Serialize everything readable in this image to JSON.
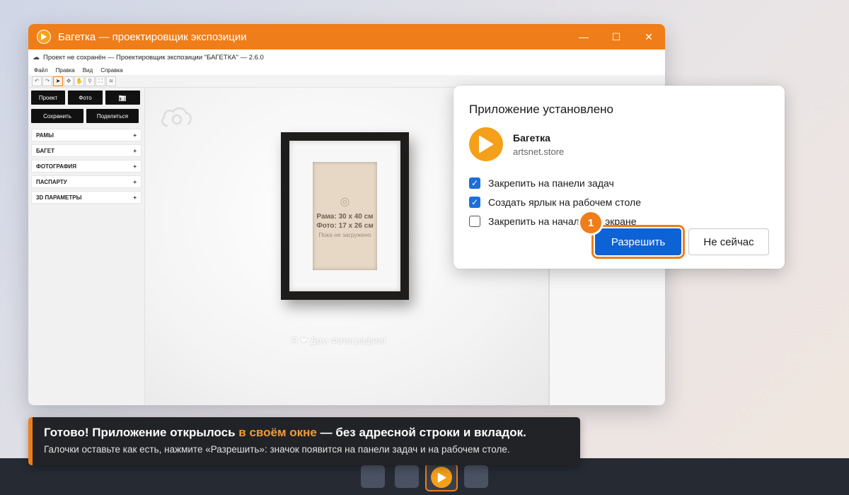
{
  "window": {
    "title": "Багетка — проектировщик экспозиции",
    "controls": {
      "minimize": "—",
      "maximize": "☐",
      "close": "✕"
    },
    "subtitle": "Проект не сохранён — Проектировщик экспозиции \"БАГЕТКА\"  — 2.6.0",
    "menu": [
      "Файл",
      "Правка",
      "Вид",
      "Справка"
    ],
    "toolbar_icons": [
      "undo-icon",
      "redo-icon",
      "pointer-icon",
      "move-icon",
      "hand-icon",
      "zoom-icon",
      "fit-icon",
      "layers-icon"
    ],
    "toolbar_glyphs": [
      "↶",
      "↷",
      "➤",
      "✥",
      "✋",
      "⚲",
      "⛶",
      "≋"
    ]
  },
  "sidebar": {
    "buttons": {
      "project": "Проект",
      "photo": "Фото",
      "camera": "📷",
      "save": "Сохранить",
      "share": "Поделиться"
    },
    "sections": [
      {
        "label": "РАМЫ",
        "toggle": "+"
      },
      {
        "label": "БАГЕТ",
        "toggle": "+"
      },
      {
        "label": "ФОТОГРАФИЯ",
        "toggle": "+"
      },
      {
        "label": "ПАСПАРТУ",
        "toggle": "+"
      },
      {
        "label": "3D ПАРАМЕТРЫ",
        "toggle": "+"
      }
    ]
  },
  "canvas": {
    "frame_size": "Рама: 30 x 40 см",
    "photo_size": "Фото: 17 x 26 см",
    "status": "Пока не загружено",
    "watermark_prefix": "Я",
    "watermark_heart": "❤",
    "watermark_suffix": "Дом Фотографии!"
  },
  "dialog": {
    "title": "Приложение установлено",
    "app_name": "Багетка",
    "app_host": "artsnet.store",
    "options": [
      {
        "label": "Закрепить на панели задач",
        "checked": true
      },
      {
        "label": "Создать ярлык на рабочем столе",
        "checked": true
      },
      {
        "label": "Закрепить на начальном экране",
        "checked": false
      }
    ],
    "allow": "Разрешить",
    "later": "Не сейчас",
    "step": "1"
  },
  "tip": {
    "line1_a": "Готово! Приложение открылось ",
    "line1_hl": "в своём окне",
    "line1_b": " — без адресной строки и вкладок.",
    "line2": "Галочки оставьте как есть, нажмите «Разрешить»: значок появится на панели задач и на рабочем столе."
  },
  "colors": {
    "accent": "#ee7d1a",
    "primary": "#0d62d6",
    "taskbar": "#262a33"
  }
}
